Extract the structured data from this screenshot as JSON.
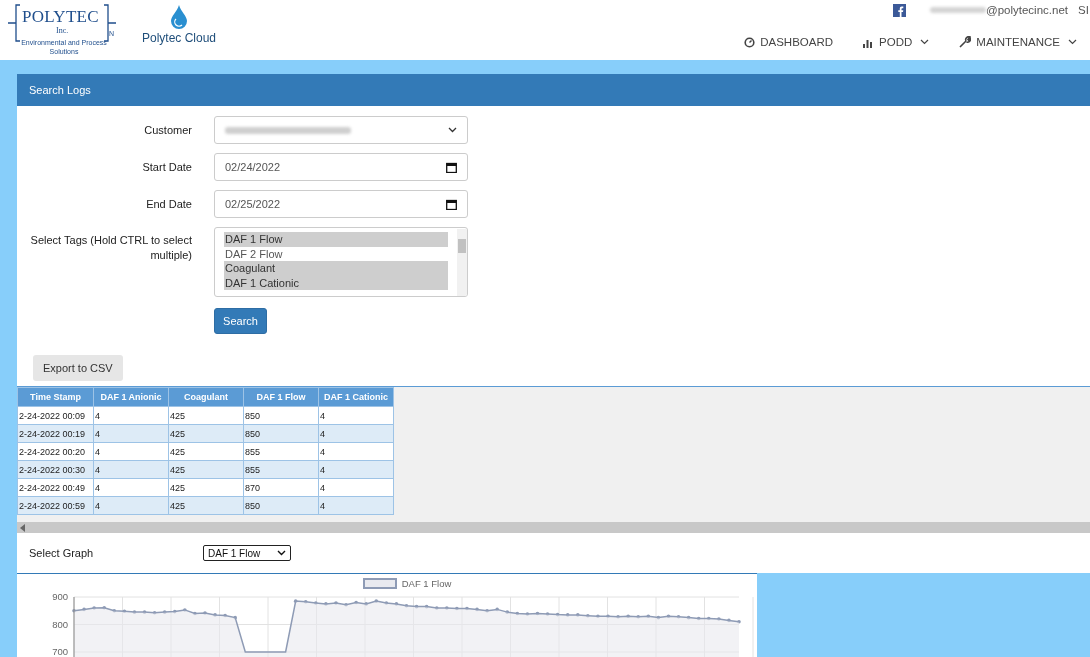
{
  "header": {
    "logo": {
      "name": "POLYTEC",
      "sub": "Inc.",
      "mark": "N",
      "tagline": "Environmental and Process Solutions"
    },
    "brand": "Polytec Cloud",
    "email": "@polytecinc.net",
    "signout": "SI",
    "nav": [
      {
        "label": "DASHBOARD",
        "dropdown": false
      },
      {
        "label": "PODD",
        "dropdown": true
      },
      {
        "label": "MAINTENANCE",
        "dropdown": true
      }
    ]
  },
  "search_panel": {
    "title": "Search Logs",
    "fields": [
      {
        "label": "Customer",
        "kind": "select"
      },
      {
        "label": "Start Date",
        "kind": "date",
        "value": "02/24/2022"
      },
      {
        "label": "End Date",
        "kind": "date",
        "value": "02/25/2022"
      }
    ],
    "tags": {
      "label": "Select Tags (Hold CTRL to select multiple)",
      "options": [
        {
          "label": "DAF 1 Flow",
          "selected": true
        },
        {
          "label": "DAF 2 Flow",
          "selected": false
        },
        {
          "label": "Coagulant",
          "selected": true
        },
        {
          "label": "DAF 1 Cationic",
          "selected": true
        }
      ]
    },
    "search_button": "Search"
  },
  "export_button": "Export to CSV",
  "table": {
    "columns": [
      "Time Stamp",
      "DAF 1 Anionic",
      "Coagulant",
      "DAF 1 Flow",
      "DAF 1 Cationic"
    ],
    "rows": [
      [
        "2-24-2022 00:09",
        "4",
        "425",
        "850",
        "4"
      ],
      [
        "2-24-2022 00:19",
        "4",
        "425",
        "850",
        "4"
      ],
      [
        "2-24-2022 00:20",
        "4",
        "425",
        "855",
        "4"
      ],
      [
        "2-24-2022 00:30",
        "4",
        "425",
        "855",
        "4"
      ],
      [
        "2-24-2022 00:49",
        "4",
        "425",
        "870",
        "4"
      ],
      [
        "2-24-2022 00:59",
        "4",
        "425",
        "850",
        "4"
      ]
    ]
  },
  "graph": {
    "label": "Select Graph",
    "selected": "DAF 1 Flow",
    "chart_data": {
      "type": "area",
      "ylim": [
        700,
        900
      ],
      "yticks": [
        700,
        800,
        900
      ],
      "grid": true,
      "series": [
        {
          "name": "DAF 1 Flow",
          "color": "#8e9bb5",
          "values": [
            850,
            855,
            860,
            861,
            850,
            848,
            845,
            845,
            843,
            845,
            847,
            853,
            840,
            842,
            835,
            833,
            825,
            700,
            700,
            700,
            700,
            700,
            885,
            883,
            878,
            875,
            878,
            872,
            880,
            875,
            885,
            878,
            875,
            868,
            865,
            865,
            860,
            860,
            858,
            858,
            855,
            850,
            855,
            845,
            840,
            838,
            840,
            838,
            836,
            835,
            835,
            832,
            830,
            830,
            828,
            830,
            828,
            830,
            825,
            830,
            828,
            825,
            822,
            822,
            820,
            815,
            810
          ]
        }
      ]
    }
  }
}
